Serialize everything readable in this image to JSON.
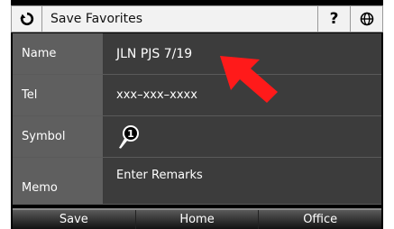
{
  "header": {
    "back_icon": "refresh-back-icon",
    "title": "Save Favorites",
    "help_label": "?",
    "globe_icon": "globe-icon"
  },
  "fields": {
    "name_label": "Name",
    "name_value": "JLN PJS 7/19",
    "tel_label": "Tel",
    "tel_value": "xxx–xxx–xxxx",
    "symbol_label": "Symbol",
    "symbol_icon": "location-pin-1-icon",
    "symbol_badge": "1",
    "memo_label": "Memo",
    "memo_value": "Enter Remarks"
  },
  "footer": {
    "save_label": "Save",
    "home_label": "Home",
    "office_label": "Office"
  },
  "colors": {
    "arrow": "#ff1a1a",
    "label_bg": "#5f5f5f",
    "value_bg": "#3c3c3c"
  }
}
